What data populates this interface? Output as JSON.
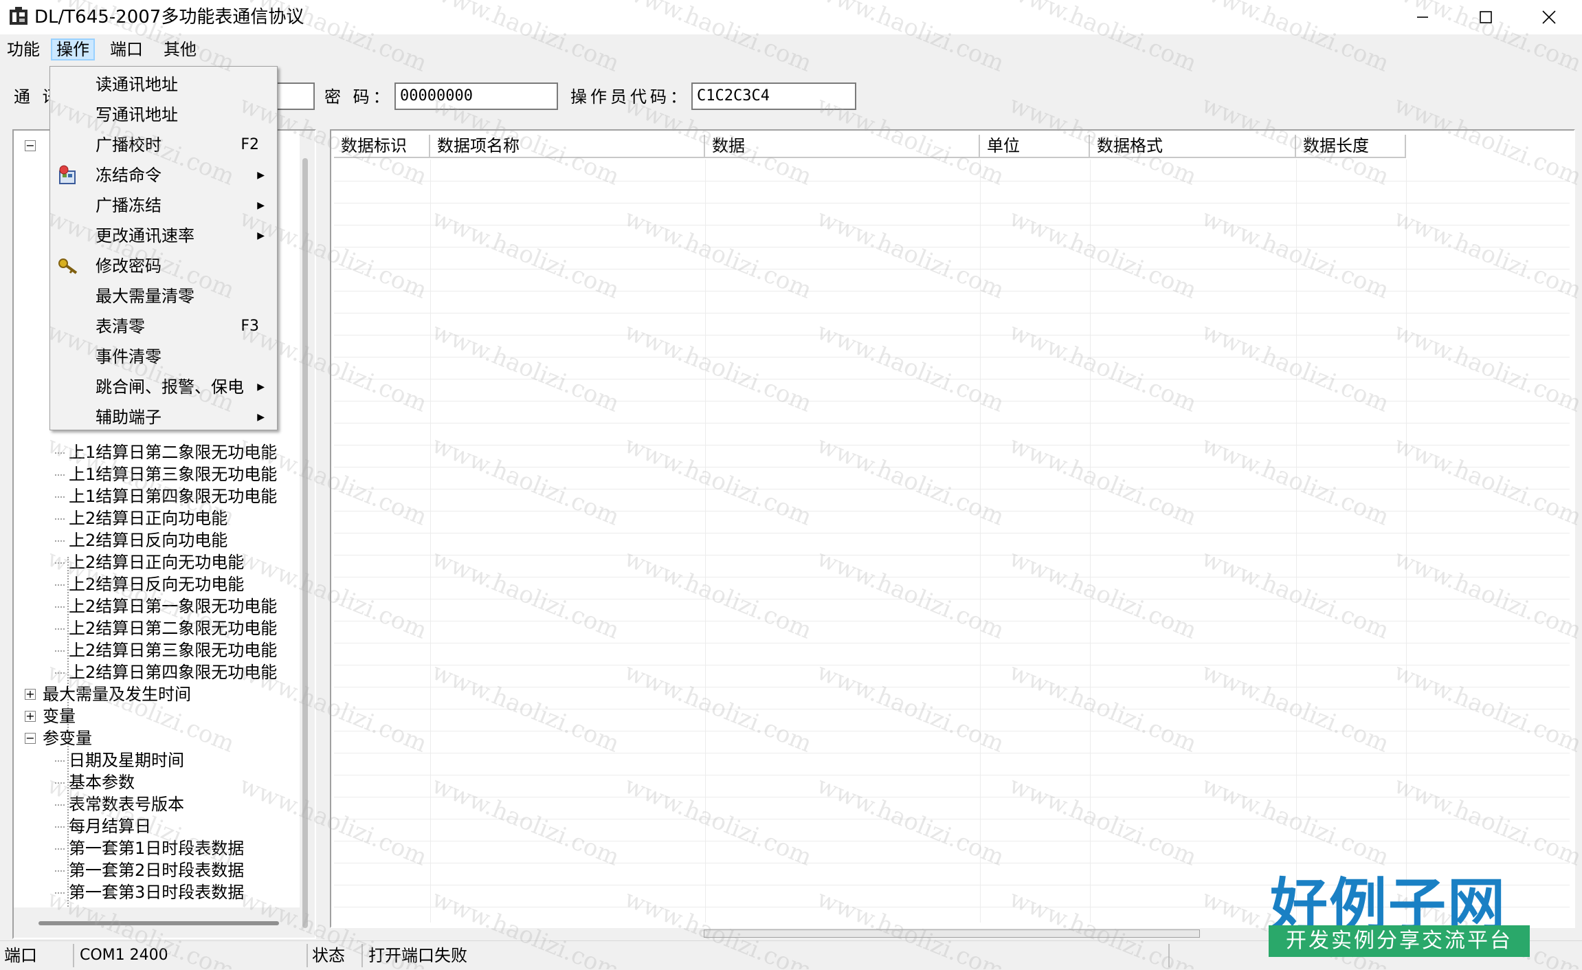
{
  "window": {
    "title": "DL/T645-2007多功能表通信协议"
  },
  "menubar": {
    "items": [
      {
        "label": "功能"
      },
      {
        "label": "操作"
      },
      {
        "label": "端口"
      },
      {
        "label": "其他"
      }
    ]
  },
  "toolbar": {
    "address_label": "通 讯",
    "password_label": "密 码：",
    "password_value": "00000000",
    "operator_label": "操作员代码：",
    "operator_value": "C1C2C3C4"
  },
  "dropdown": {
    "items": [
      {
        "label": "读通讯地址",
        "shortcut": "",
        "submenu": false,
        "icon": ""
      },
      {
        "label": "写通讯地址",
        "shortcut": "",
        "submenu": false,
        "icon": ""
      },
      {
        "label": "广播校时",
        "shortcut": "F2",
        "submenu": false,
        "icon": ""
      },
      {
        "label": "冻结命令",
        "shortcut": "",
        "submenu": true,
        "icon": "freeze-icon"
      },
      {
        "label": "广播冻结",
        "shortcut": "",
        "submenu": true,
        "icon": ""
      },
      {
        "label": "更改通讯速率",
        "shortcut": "",
        "submenu": true,
        "icon": ""
      },
      {
        "label": "修改密码",
        "shortcut": "",
        "submenu": false,
        "icon": "key-icon"
      },
      {
        "label": "最大需量清零",
        "shortcut": "",
        "submenu": false,
        "icon": ""
      },
      {
        "label": "表清零",
        "shortcut": "F3",
        "submenu": false,
        "icon": ""
      },
      {
        "label": "事件清零",
        "shortcut": "",
        "submenu": false,
        "icon": ""
      },
      {
        "label": "跳合闸、报警、保电",
        "shortcut": "",
        "submenu": true,
        "icon": ""
      },
      {
        "label": "辅助端子",
        "shortcut": "",
        "submenu": true,
        "icon": ""
      }
    ]
  },
  "tree": {
    "rows": [
      {
        "label": "上1结算日第二象限无功电能",
        "level": 2
      },
      {
        "label": "上1结算日第三象限无功电能",
        "level": 2
      },
      {
        "label": "上1结算日第四象限无功电能",
        "level": 2
      },
      {
        "label": "上2结算日正向功电能",
        "level": 2
      },
      {
        "label": "上2结算日反向功电能",
        "level": 2
      },
      {
        "label": "上2结算日正向无功电能",
        "level": 2
      },
      {
        "label": "上2结算日反向无功电能",
        "level": 2
      },
      {
        "label": "上2结算日第一象限无功电能",
        "level": 2
      },
      {
        "label": "上2结算日第二象限无功电能",
        "level": 2
      },
      {
        "label": "上2结算日第三象限无功电能",
        "level": 2
      },
      {
        "label": "上2结算日第四象限无功电能",
        "level": 2
      },
      {
        "label": "最大需量及发生时间",
        "level": 1,
        "expander": "+"
      },
      {
        "label": "变量",
        "level": 1,
        "expander": "+"
      },
      {
        "label": "参变量",
        "level": 1,
        "expander": "-"
      },
      {
        "label": "日期及星期时间",
        "level": 2
      },
      {
        "label": "基本参数",
        "level": 2
      },
      {
        "label": "表常数表号版本",
        "level": 2
      },
      {
        "label": "每月结算日",
        "level": 2
      },
      {
        "label": "第一套第1日时段表数据",
        "level": 2
      },
      {
        "label": "第一套第2日时段表数据",
        "level": 2
      },
      {
        "label": "第一套第3日时段表数据",
        "level": 2
      }
    ]
  },
  "grid": {
    "columns": [
      {
        "label": "数据标识"
      },
      {
        "label": "数据项名称"
      },
      {
        "label": "数据"
      },
      {
        "label": "单位"
      },
      {
        "label": "数据格式"
      },
      {
        "label": "数据长度"
      }
    ]
  },
  "statusbar": {
    "port_label": "端口",
    "port_value": "COM1 2400",
    "state_label": "状态",
    "state_value": "打开端口失败"
  },
  "watermark": {
    "text": "www.haolizi.com",
    "logo_main": "好例子网",
    "logo_sub": "开发实例分享交流平台"
  }
}
